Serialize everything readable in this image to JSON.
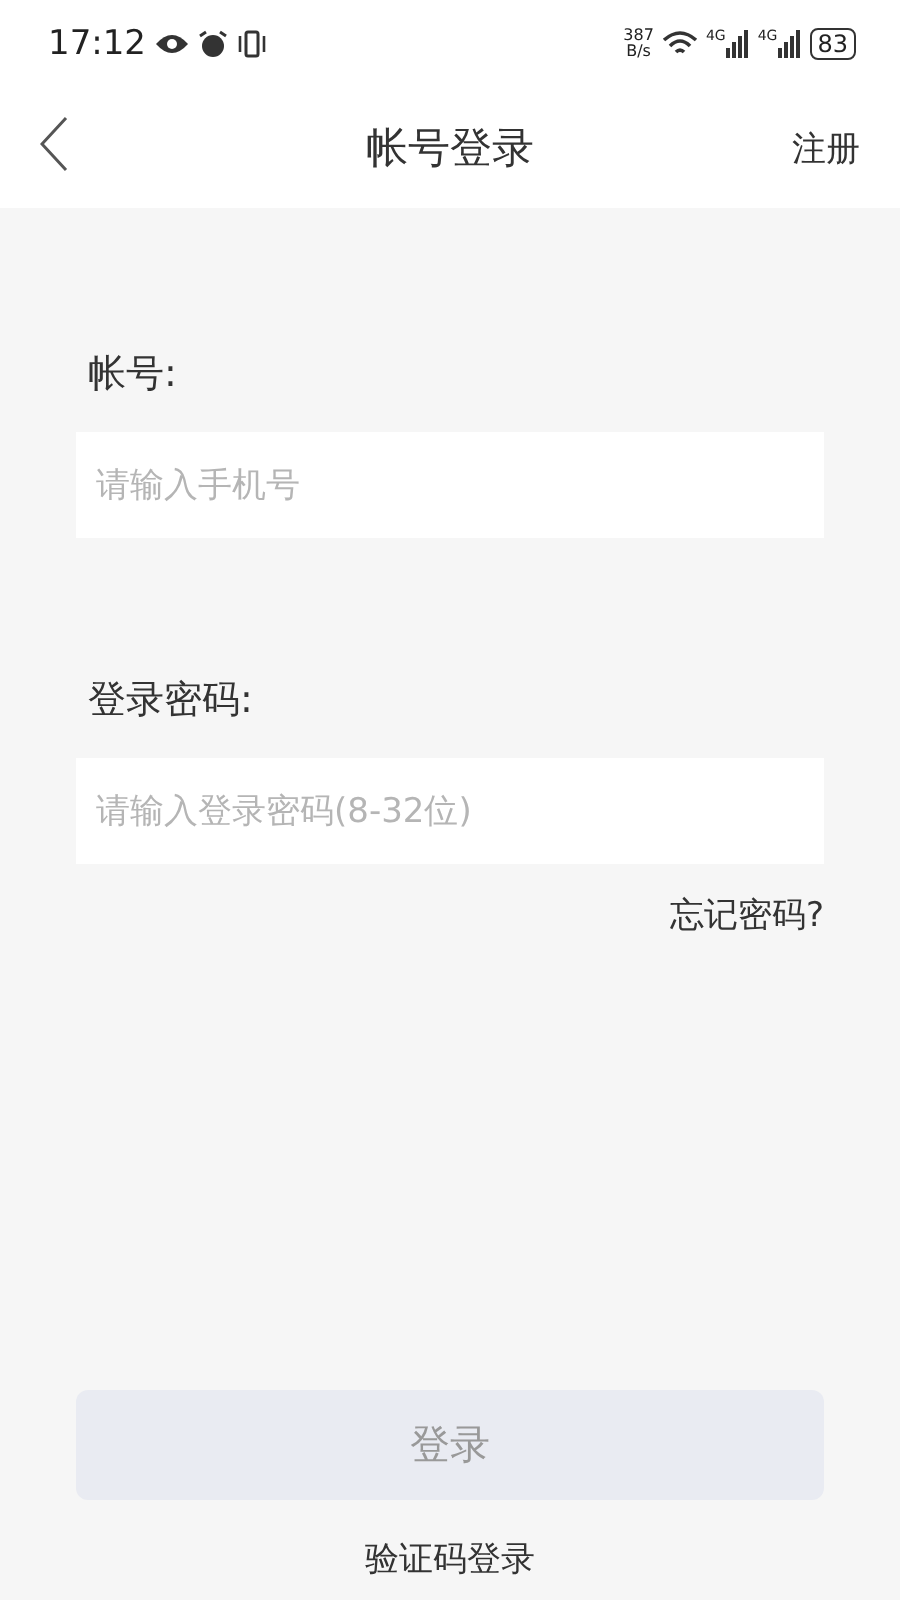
{
  "status_bar": {
    "time": "17:12",
    "net_speed_value": "387",
    "net_speed_unit": "B/s",
    "network_1": "4G",
    "network_2": "4G",
    "battery": "83"
  },
  "header": {
    "title": "帐号登录",
    "action": "注册"
  },
  "fields": [
    {
      "label": "帐号:",
      "placeholder": "请输入手机号"
    },
    {
      "label": "登录密码:",
      "placeholder": "请输入登录密码(8-32位)"
    }
  ],
  "forgot_link": "忘记密码?",
  "login_button": {
    "label": "登录",
    "disabled": true
  },
  "alt_login": "验证码登录"
}
